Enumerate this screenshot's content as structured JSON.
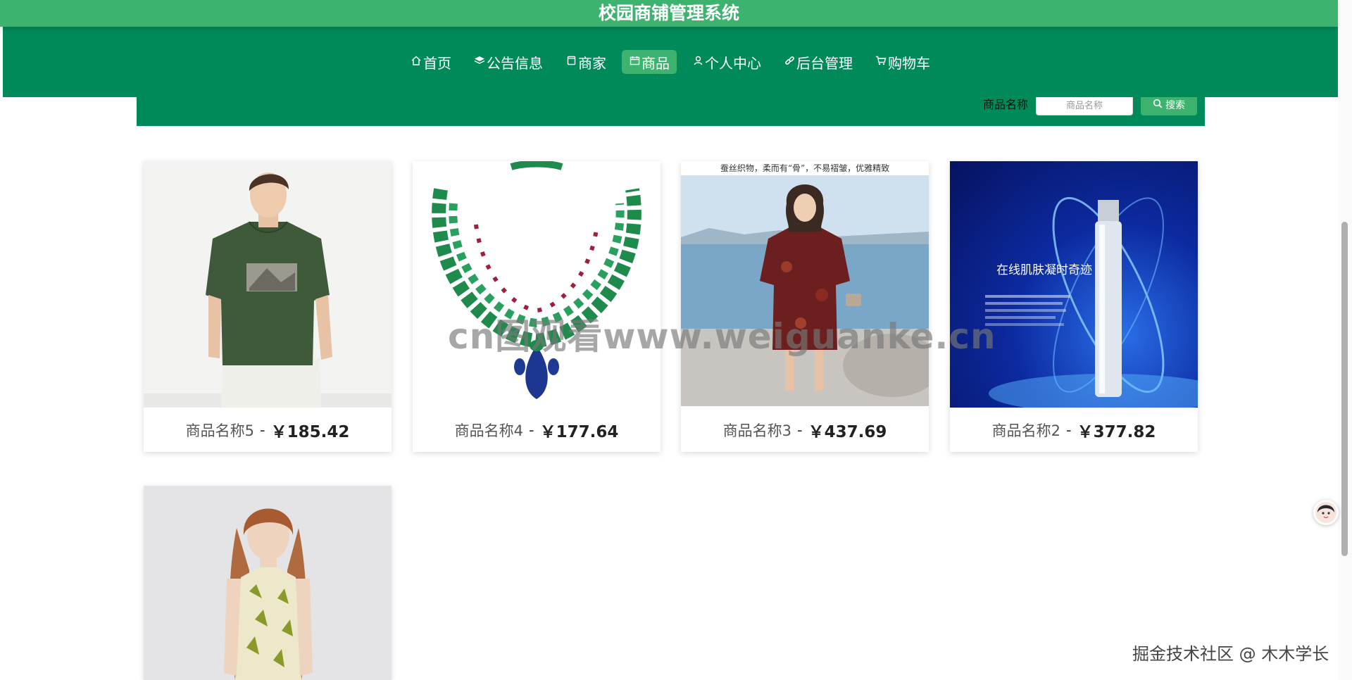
{
  "app": {
    "title": "校园商铺管理系统"
  },
  "nav": {
    "items": [
      {
        "icon": "home-icon",
        "label": "首页"
      },
      {
        "icon": "layers-icon",
        "label": "公告信息"
      },
      {
        "icon": "store-icon",
        "label": "商家"
      },
      {
        "icon": "calendar-icon",
        "label": "商品"
      },
      {
        "icon": "user-icon",
        "label": "个人中心"
      },
      {
        "icon": "link-icon",
        "label": "后台管理"
      },
      {
        "icon": "cart-icon",
        "label": "购物车"
      }
    ],
    "active_label": "商品"
  },
  "search": {
    "label": "商品名称",
    "placeholder": "商品名称",
    "value": "",
    "button_label": "搜索"
  },
  "products": [
    {
      "name": "商品名称5",
      "separator": "-",
      "price": "￥185.42",
      "image": "green-tshirt-photo"
    },
    {
      "name": "商品名称4",
      "separator": "-",
      "price": "￥177.64",
      "image": "emerald-necklace-photo"
    },
    {
      "name": "商品名称3",
      "separator": "-",
      "price": "￥437.69",
      "image": "woman-dress-photo",
      "image_caption": "蚕丝织物，柔而有“骨”，不易褶皱，优雅精致"
    },
    {
      "name": "商品名称2",
      "separator": "-",
      "price": "￥377.82",
      "image": "serum-bottle-photo",
      "image_text": "在线肌肤凝时奇迹"
    },
    {
      "name": "",
      "separator": "",
      "price": "",
      "image": "floral-dress-photo"
    }
  ],
  "overlay": {
    "watermark": "cn图观看www.weiguanke.cn",
    "footer": "掘金技术社区 @ 木木学长"
  },
  "colors": {
    "header_green": "#3db36f",
    "nav_green": "#008a5a",
    "active_green": "#3db36f"
  }
}
